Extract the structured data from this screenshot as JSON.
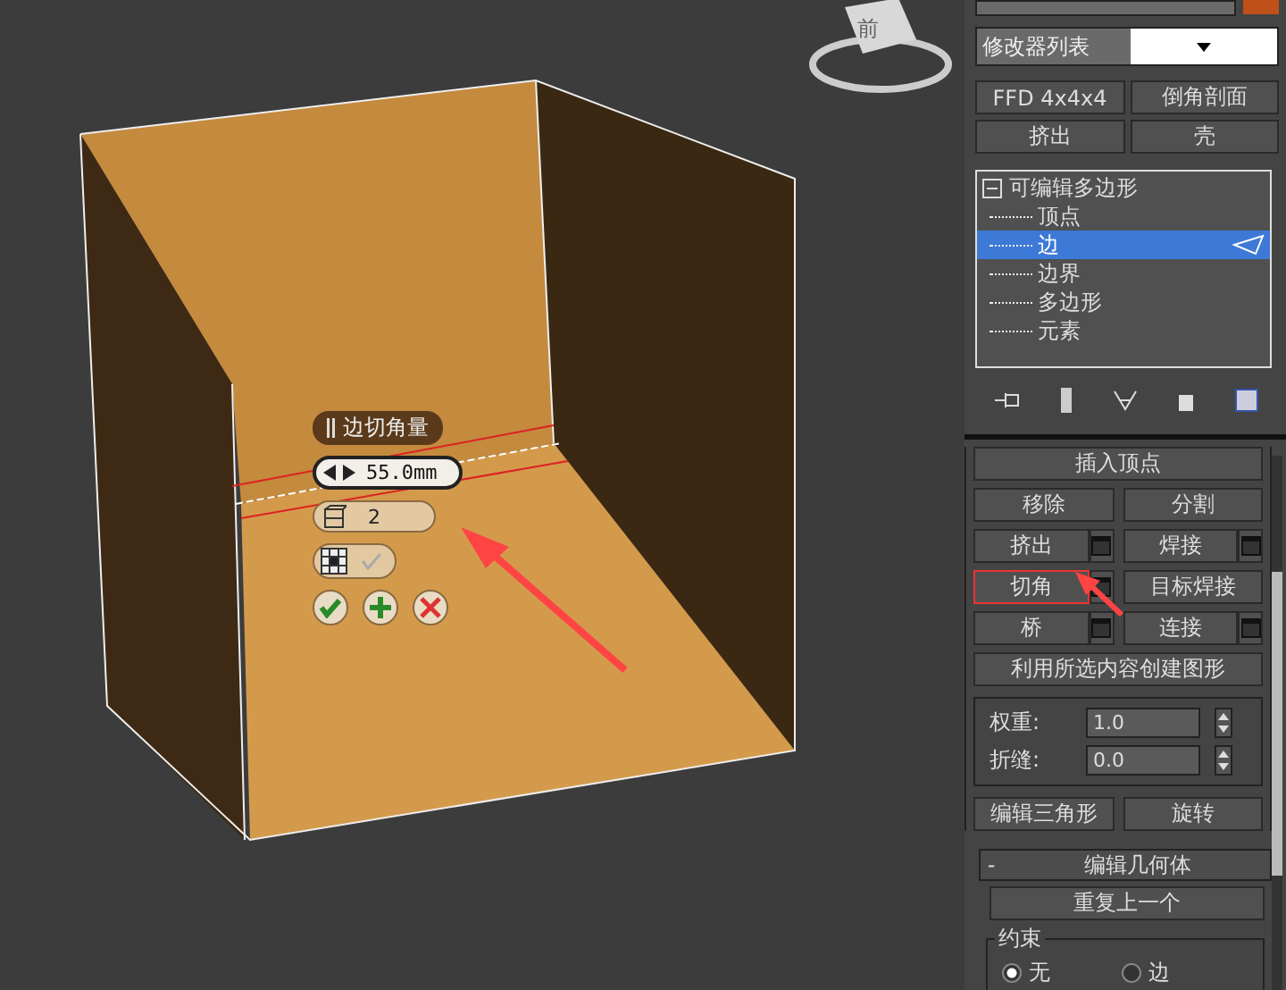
{
  "viewport": {
    "view_cube_label": "前",
    "caddy": {
      "title": "边切角量",
      "amount": "55.0mm",
      "segments": "2"
    }
  },
  "panel": {
    "modifier_list": "修改器列表",
    "modifier_buttons": [
      "FFD 4x4x4",
      "倒角剖面",
      "挤出",
      "壳"
    ],
    "stack": {
      "label": "可编辑多边形",
      "expanded": true,
      "selected": false,
      "children": [
        {
          "label": "顶点",
          "selected": false
        },
        {
          "label": "边",
          "selected": true
        },
        {
          "label": "边界",
          "selected": false
        },
        {
          "label": "多边形",
          "selected": false
        },
        {
          "label": "元素",
          "selected": false
        }
      ]
    },
    "edit_edges": {
      "rows": [
        [
          {
            "label": "插入顶点",
            "settings": false,
            "highlighted": false
          }
        ],
        [
          {
            "label": "移除",
            "settings": false,
            "highlighted": false
          },
          {
            "label": "分割",
            "settings": false,
            "highlighted": false
          }
        ],
        [
          {
            "label": "挤出",
            "settings": true,
            "highlighted": false
          },
          {
            "label": "焊接",
            "settings": true,
            "highlighted": false
          }
        ],
        [
          {
            "label": "切角",
            "settings": true,
            "highlighted": true
          },
          {
            "label": "目标焊接",
            "settings": false,
            "highlighted": false
          }
        ],
        [
          {
            "label": "桥",
            "settings": true,
            "highlighted": false
          },
          {
            "label": "连接",
            "settings": true,
            "highlighted": false
          }
        ],
        [
          {
            "label": "利用所选内容创建图形",
            "settings": false,
            "highlighted": false
          }
        ]
      ],
      "spinners": [
        {
          "label": "权重:",
          "value": "1.0"
        },
        {
          "label": "折缝:",
          "value": "0.0"
        }
      ],
      "bottom_buttons": [
        "编辑三角形",
        "旋转"
      ]
    },
    "edit_geometry": {
      "toggle": "-",
      "title": "编辑几何体",
      "repeat": "重复上一个",
      "constraints": {
        "title": "约束",
        "options": [
          {
            "label": "无",
            "selected": true
          },
          {
            "label": "边",
            "selected": false
          }
        ]
      }
    }
  }
}
